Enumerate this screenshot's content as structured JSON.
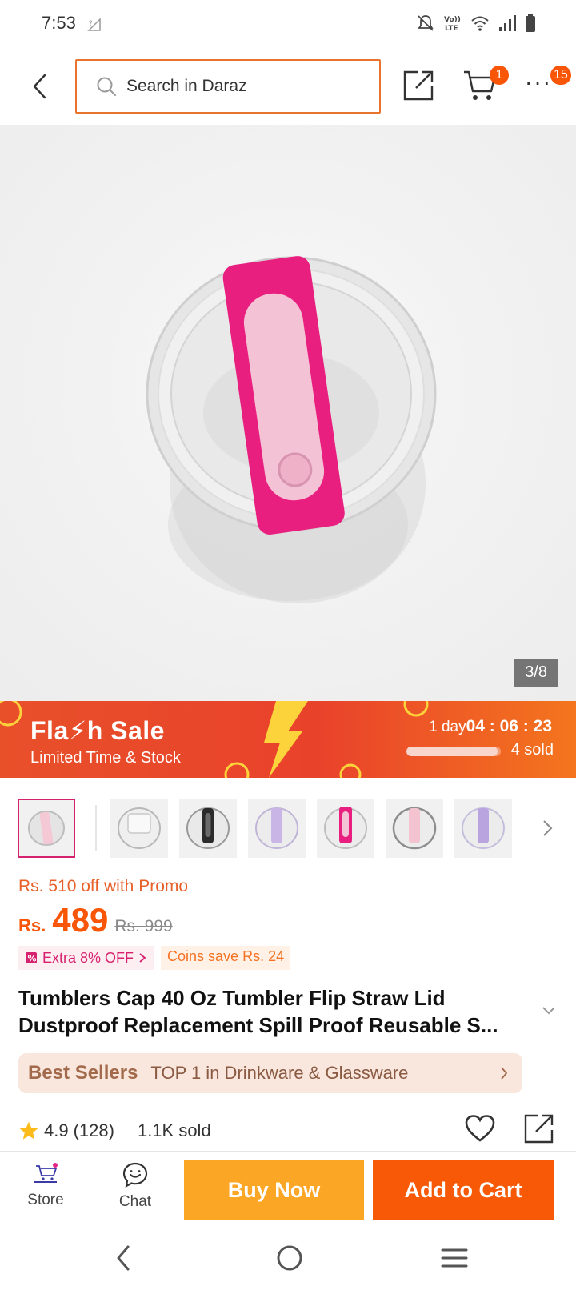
{
  "status_bar": {
    "time": "7:53",
    "icons": [
      "sim-icon",
      "mute-icon",
      "volte-icon",
      "wifi-icon",
      "signal-icon",
      "battery-icon"
    ],
    "volte_text": "Vo)) LTE"
  },
  "header": {
    "search_placeholder": "Search in Daraz",
    "cart_count": "1",
    "more_count": "15"
  },
  "product_image": {
    "counter": "3/8",
    "lid_color": "#e91f7f"
  },
  "flash_sale": {
    "title": "Fla⚡h Sale",
    "subtitle": "Limited Time & Stock",
    "timer_prefix": "1 day",
    "timer": "04 : 06 : 23",
    "sold": "4 sold",
    "sold_progress": 0.97
  },
  "thumbnails": [
    {
      "name": "thumb-1",
      "variant": "pink-grey"
    },
    {
      "name": "thumb-2",
      "variant": "clear"
    },
    {
      "name": "thumb-3",
      "variant": "black"
    },
    {
      "name": "thumb-4",
      "variant": "lavender"
    },
    {
      "name": "thumb-5",
      "variant": "hot-pink"
    },
    {
      "name": "thumb-6",
      "variant": "light-pink"
    },
    {
      "name": "thumb-7",
      "variant": "purple"
    }
  ],
  "pricing": {
    "promo": "Rs. 510 off with Promo",
    "currency": "Rs.",
    "price": "489",
    "original_price": "Rs. 999",
    "extra_off": "Extra 8% OFF",
    "coins": "Coins save Rs. 24"
  },
  "product": {
    "title": "Tumblers Cap 40 Oz Tumbler Flip Straw Lid Dustproof Replacement Spill Proof Reusable S..."
  },
  "best_sellers": {
    "label": "Best Sellers",
    "rank": "TOP 1 in Drinkware & Glassware"
  },
  "rating": {
    "score": "4.9",
    "count": "(128)",
    "sold": "1.1K sold"
  },
  "actions": {
    "store": "Store",
    "chat": "Chat",
    "buy_now": "Buy Now",
    "add_to_cart": "Add to Cart"
  },
  "colors": {
    "accent": "#f85606",
    "buy_now": "#fca625",
    "search_border": "#e8732c"
  }
}
